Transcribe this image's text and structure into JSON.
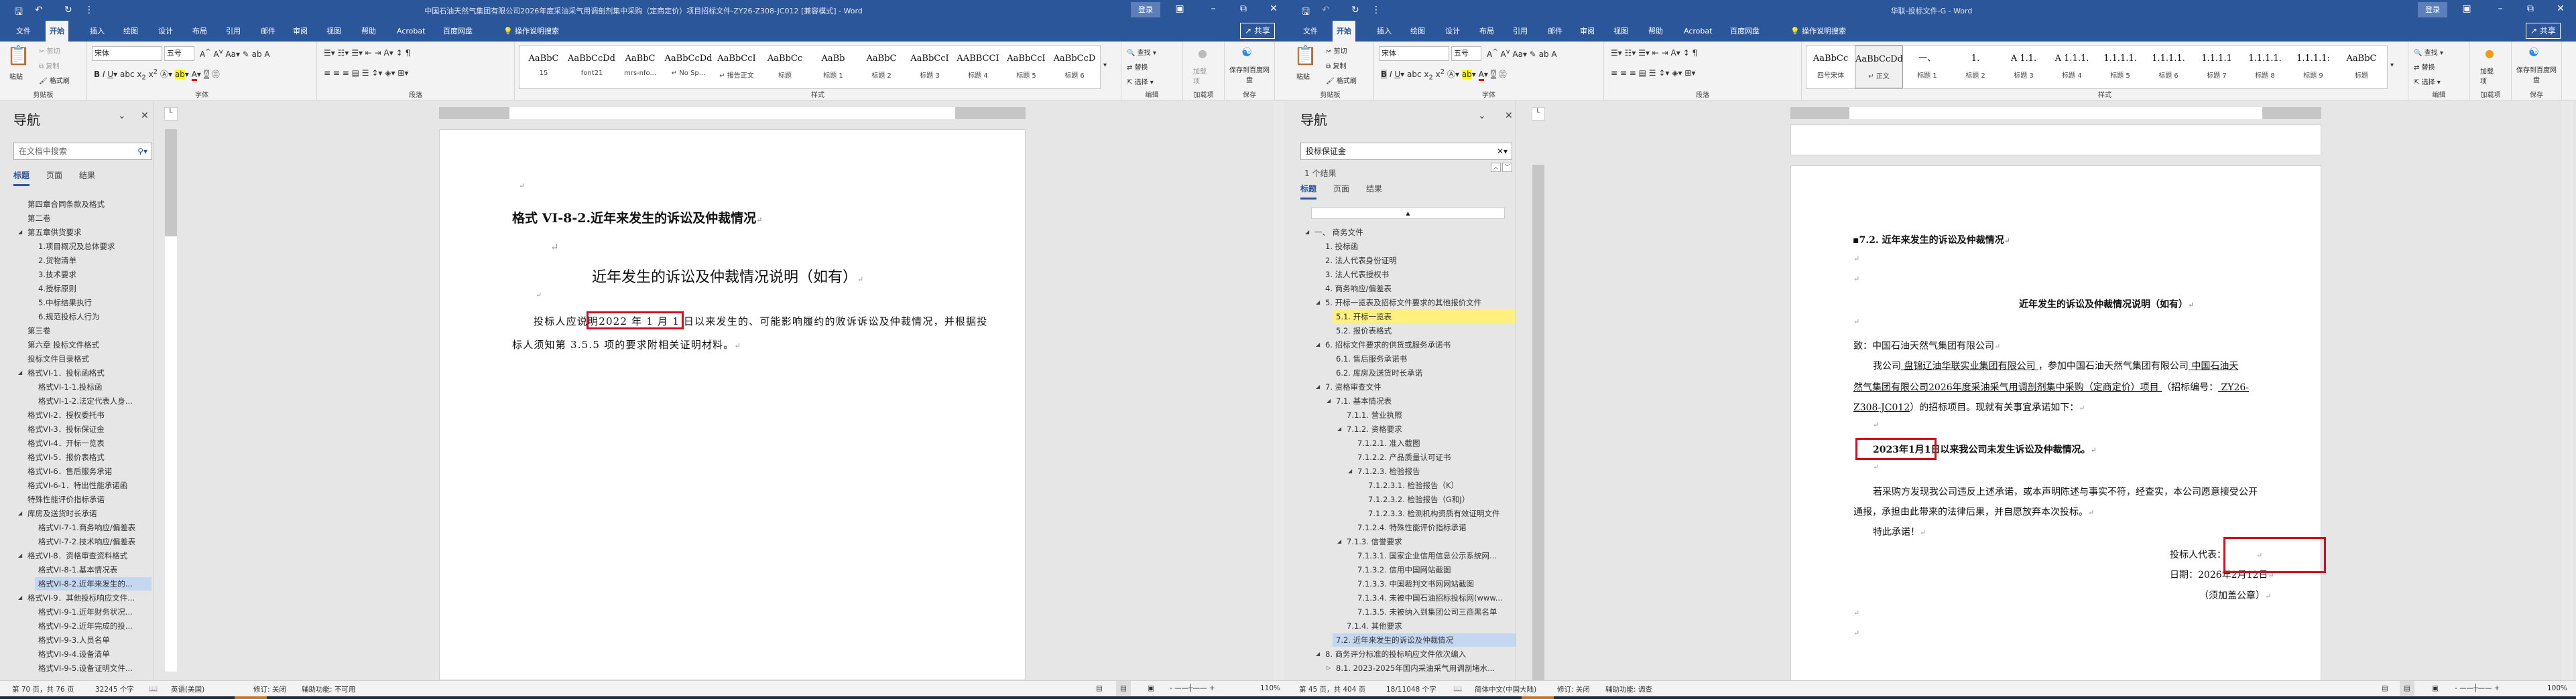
{
  "common": {
    "tabs": [
      "文件",
      "开始",
      "插入",
      "绘图",
      "设计",
      "布局",
      "引用",
      "邮件",
      "审阅",
      "视图",
      "帮助",
      "Acrobat",
      "百度网盘"
    ],
    "tell_me": "操作说明搜索",
    "share": "共享",
    "login": "登录",
    "nav_title": "导航",
    "nav_tabs": [
      "标题",
      "页面",
      "结果"
    ],
    "clipboard": {
      "paste": "粘贴",
      "cut": "剪切",
      "copy": "复制",
      "format_painter": "格式刷",
      "label": "剪贴板"
    },
    "font": {
      "name": "宋体",
      "size": "五号",
      "label": "字体"
    },
    "paragraph_label": "段落",
    "styles_label": "样式",
    "editing": {
      "find": "查找",
      "replace": "替换",
      "select": "选择",
      "label": "编辑"
    },
    "addins": {
      "button": "加载项",
      "label": "加载项"
    },
    "save": {
      "button": "保存到百度网盘",
      "label": "保存"
    },
    "accent": "#2b579a",
    "highlight_box_color": "#d0101f"
  },
  "left": {
    "title": "中国石油天然气集团有限公司2026年度采油采气用调剖剂集中采购（定商定价）项目招标文件-ZY26-Z308-JC012 [兼容模式]  -  Word",
    "styles": [
      {
        "preview": "AaBbC",
        "name": "15"
      },
      {
        "preview": "AaBbCcDdE",
        "name": "font21"
      },
      {
        "preview": "AaBbC",
        "name": "mrs-nfo..."
      },
      {
        "preview": "AaBbCcDd",
        "name": "↵ No Sp..."
      },
      {
        "preview": "AaBbCcI",
        "name": "↵ 报告正文"
      },
      {
        "preview": "AaBbCc",
        "name": "标题"
      },
      {
        "preview": "AaBb",
        "name": "标题 1"
      },
      {
        "preview": "AaBbC",
        "name": "标题 2"
      },
      {
        "preview": "AaBbCcI",
        "name": "标题 3"
      },
      {
        "preview": "AABBCCI",
        "name": "标题 4"
      },
      {
        "preview": "AaBbCcI",
        "name": "标题 5"
      },
      {
        "preview": "AaBbCcD",
        "name": "标题 6"
      }
    ],
    "search_placeholder": "在文档中搜索",
    "nav_items": [
      {
        "label": "第四章合同条款及格式",
        "level": 0
      },
      {
        "label": "第二卷",
        "level": 0
      },
      {
        "label": "第五章供货要求",
        "level": 0,
        "open": true
      },
      {
        "label": "1.项目概况及总体要求",
        "level": 1
      },
      {
        "label": "2.货物清单",
        "level": 1
      },
      {
        "label": "3.技术要求",
        "level": 1
      },
      {
        "label": "4.授标原则",
        "level": 1
      },
      {
        "label": "5.中标结果执行",
        "level": 1
      },
      {
        "label": "6.规范投标人行为",
        "level": 1
      },
      {
        "label": "第三卷",
        "level": 0
      },
      {
        "label": "第六章 投标文件格式",
        "level": 0
      },
      {
        "label": "投标文件目录格式",
        "level": 0
      },
      {
        "label": "格式VI-1．投标函格式",
        "level": 0,
        "open": true
      },
      {
        "label": "格式VI-1-1.投标函",
        "level": 1
      },
      {
        "label": "格式VI-1-2.法定代表人身...",
        "level": 1
      },
      {
        "label": "格式VI-2．授权委托书",
        "level": 0
      },
      {
        "label": "格式VI-3．投标保证金",
        "level": 0
      },
      {
        "label": "格式VI-4．开标一览表",
        "level": 0
      },
      {
        "label": "格式VI-5．报价表格式",
        "level": 0
      },
      {
        "label": "格式VI-6．售后服务承诺",
        "level": 0
      },
      {
        "label": "格式VI-6-1．特出性能承诺函",
        "level": 0
      },
      {
        "label": "特殊性能评价指标承诺",
        "level": 0
      },
      {
        "label": "库房及送货时长承诺",
        "level": 0,
        "open": true
      },
      {
        "label": "格式VI-7-1.商务响应/偏差表",
        "level": 1
      },
      {
        "label": "格式VI-7-2.技术响应/偏差表",
        "level": 1
      },
      {
        "label": "格式VI-8．资格审查资料格式",
        "level": 0,
        "open": true
      },
      {
        "label": "格式VI-8-1.基本情况表",
        "level": 1
      },
      {
        "label": "格式VI-8-2.近年来发生的...",
        "level": 1,
        "current": true
      },
      {
        "label": "格式VI-9．其他投标响应文件...",
        "level": 0,
        "open": true
      },
      {
        "label": "格式VI-9-1.近年财务状况...",
        "level": 1
      },
      {
        "label": "格式VI-9-2.近年完成的投...",
        "level": 1
      },
      {
        "label": "格式VI-9-3.人员名单",
        "level": 1
      },
      {
        "label": "格式VI-9-4.设备清单",
        "level": 1
      },
      {
        "label": "格式VI-9-5.设备证明文件...",
        "level": 1
      }
    ],
    "doc": {
      "heading": "格式 VI-8-2.近年来发生的诉讼及仲裁情况",
      "title": "近年发生的诉讼及仲裁情况说明（如有）",
      "para_a": "投标人应说明",
      "para_hl": "2022 年 1 月 1 日以",
      "para_b": "来发生的、可能影响履约的败诉诉讼及仲裁情况，并根据投",
      "para_line2": "标人须知第 3.5.5 项的要求附相关证明材料。"
    },
    "status": {
      "page": "第 70 页，共 76 页",
      "words": "32245 个字",
      "language": "英语(美国)",
      "track": "修订: 关闭",
      "accessibility": "辅助功能: 不可用",
      "zoom": "110%"
    }
  },
  "right": {
    "title": "华联-投标文件-G  -  Word",
    "styles": [
      {
        "preview": "AaBbCc",
        "name": "四号宋体"
      },
      {
        "preview": "AaBbCcDd",
        "name": "↵ 正文"
      },
      {
        "preview": "一、",
        "name": "标题 1"
      },
      {
        "preview": "1.",
        "name": "标题 2"
      },
      {
        "preview": "A 1.1.",
        "name": "标题 3"
      },
      {
        "preview": "A 1.1.1.",
        "name": "标题 4"
      },
      {
        "preview": "1.1.1.1.",
        "name": "标题 5"
      },
      {
        "preview": "1.1.1.1.",
        "name": "标题 6"
      },
      {
        "preview": "1.1.1.1",
        "name": "标题 7"
      },
      {
        "preview": "1.1.1.1.",
        "name": "标题 8"
      },
      {
        "preview": "1.1.1.1:",
        "name": "标题 9"
      },
      {
        "preview": "AaBbC",
        "name": "标题"
      }
    ],
    "search_value": "投标保证金",
    "result_count": "1 个结果",
    "nav_items": [
      {
        "label": "一、  商务文件",
        "level": 0,
        "open": true
      },
      {
        "label": "1. 投标函",
        "level": 1
      },
      {
        "label": "2. 法人代表身份证明",
        "level": 1
      },
      {
        "label": "3. 法人代表授权书",
        "level": 1
      },
      {
        "label": "4. 商务响应/偏差表",
        "level": 1
      },
      {
        "label": "5. 开标一览表及招标文件要求的其他报价文件",
        "level": 1,
        "open": true
      },
      {
        "label": "5.1. 开标一览表",
        "level": 2,
        "found": true
      },
      {
        "label": "5.2. 报价表格式",
        "level": 2
      },
      {
        "label": "6. 招标文件要求的供货或服务承诺书",
        "level": 1,
        "open": true
      },
      {
        "label": "6.1. 售后服务承诺书",
        "level": 2
      },
      {
        "label": "6.2. 库房及送货时长承诺",
        "level": 2
      },
      {
        "label": "7. 资格审查文件",
        "level": 1,
        "open": true
      },
      {
        "label": "7.1. 基本情况表",
        "level": 2,
        "open": true
      },
      {
        "label": "7.1.1. 营业执照",
        "level": 3
      },
      {
        "label": "7.1.2. 资格要求",
        "level": 3,
        "open": true
      },
      {
        "label": "7.1.2.1. 准入截图",
        "level": 4
      },
      {
        "label": "7.1.2.2. 产品质量认可证书",
        "level": 4
      },
      {
        "label": "7.1.2.3. 检验报告",
        "level": 4,
        "open": true
      },
      {
        "label": "7.1.2.3.1. 检验报告（K）",
        "level": 5
      },
      {
        "label": "7.1.2.3.2. 检验报告（G和J）",
        "level": 5
      },
      {
        "label": "7.1.2.3.3. 检测机构资质有效证明文件",
        "level": 5
      },
      {
        "label": "7.1.2.4. 特殊性能评价指标承诺",
        "level": 4
      },
      {
        "label": "7.1.3. 信誉要求",
        "level": 3,
        "open": true
      },
      {
        "label": "7.1.3.1. 国家企业信用信息公示系统网...",
        "level": 4
      },
      {
        "label": "7.1.3.2. 信用中国网站截图",
        "level": 4
      },
      {
        "label": "7.1.3.3. 中国裁判文书网网站截图",
        "level": 4
      },
      {
        "label": "7.1.3.4. 未被中国石油招标投标网(www...",
        "level": 4
      },
      {
        "label": "7.1.3.5. 未被纳入到集团公司三商黑名单",
        "level": 4
      },
      {
        "label": "7.1.4. 其他要求",
        "level": 3
      },
      {
        "label": "7.2. 近年来发生的诉讼及仲裁情况",
        "level": 2,
        "current": true
      },
      {
        "label": "8. 商务评分标准的投标响应文件依次编入",
        "level": 1,
        "open": true
      },
      {
        "label": "8.1. 2023-2025年国内采油采气用调剖堵水...",
        "level": 2,
        "closed": true
      }
    ],
    "doc": {
      "heading": "7.2. 近年来发生的诉讼及仲裁情况",
      "title": "近年发生的诉讼及仲裁情况说明（如有）",
      "to": "致：中国石油天然气集团有限公司",
      "p1_a": "我公司",
      "p1_company": " 盘锦辽油华联实业集团有限公司 ",
      "p1_b": "，参加中国石油天然气集团有限公司",
      "p1_project1": "    中国石油天",
      "p1_project2": "然气集团有限公司2026年度采油采气用调剖剂集中采购（定商定价）项目    ",
      "p1_c": "（招标编号：",
      "p1_code1": " ZY26-",
      "p1_code2": "Z308-JC012",
      "p1_d": "）的招标项目。现就有关事宜承诺如下：",
      "statement_hl": "2023年1月1日以",
      "statement": "来我公司未发生诉讼及仲裁情况。",
      "p2_line1": "若采购方发现我公司违反上述承诺，或本声明陈述与事实不符，经查实，本公司愿意接受公开",
      "p2_line2": "通报，承担由此带来的法律后果，并自愿放弃本次投标。",
      "closing": "特此承诺！",
      "rep": "投标人代表：",
      "date": "日期：2026年2月12日",
      "seal": "（须加盖公章）"
    },
    "status": {
      "page": "第 45 页，共 404 页",
      "words": "18/11048 个字",
      "language": "简体中文(中国大陆)",
      "track": "修订: 关闭",
      "accessibility": "辅助功能: 调查",
      "zoom": "100%"
    }
  }
}
